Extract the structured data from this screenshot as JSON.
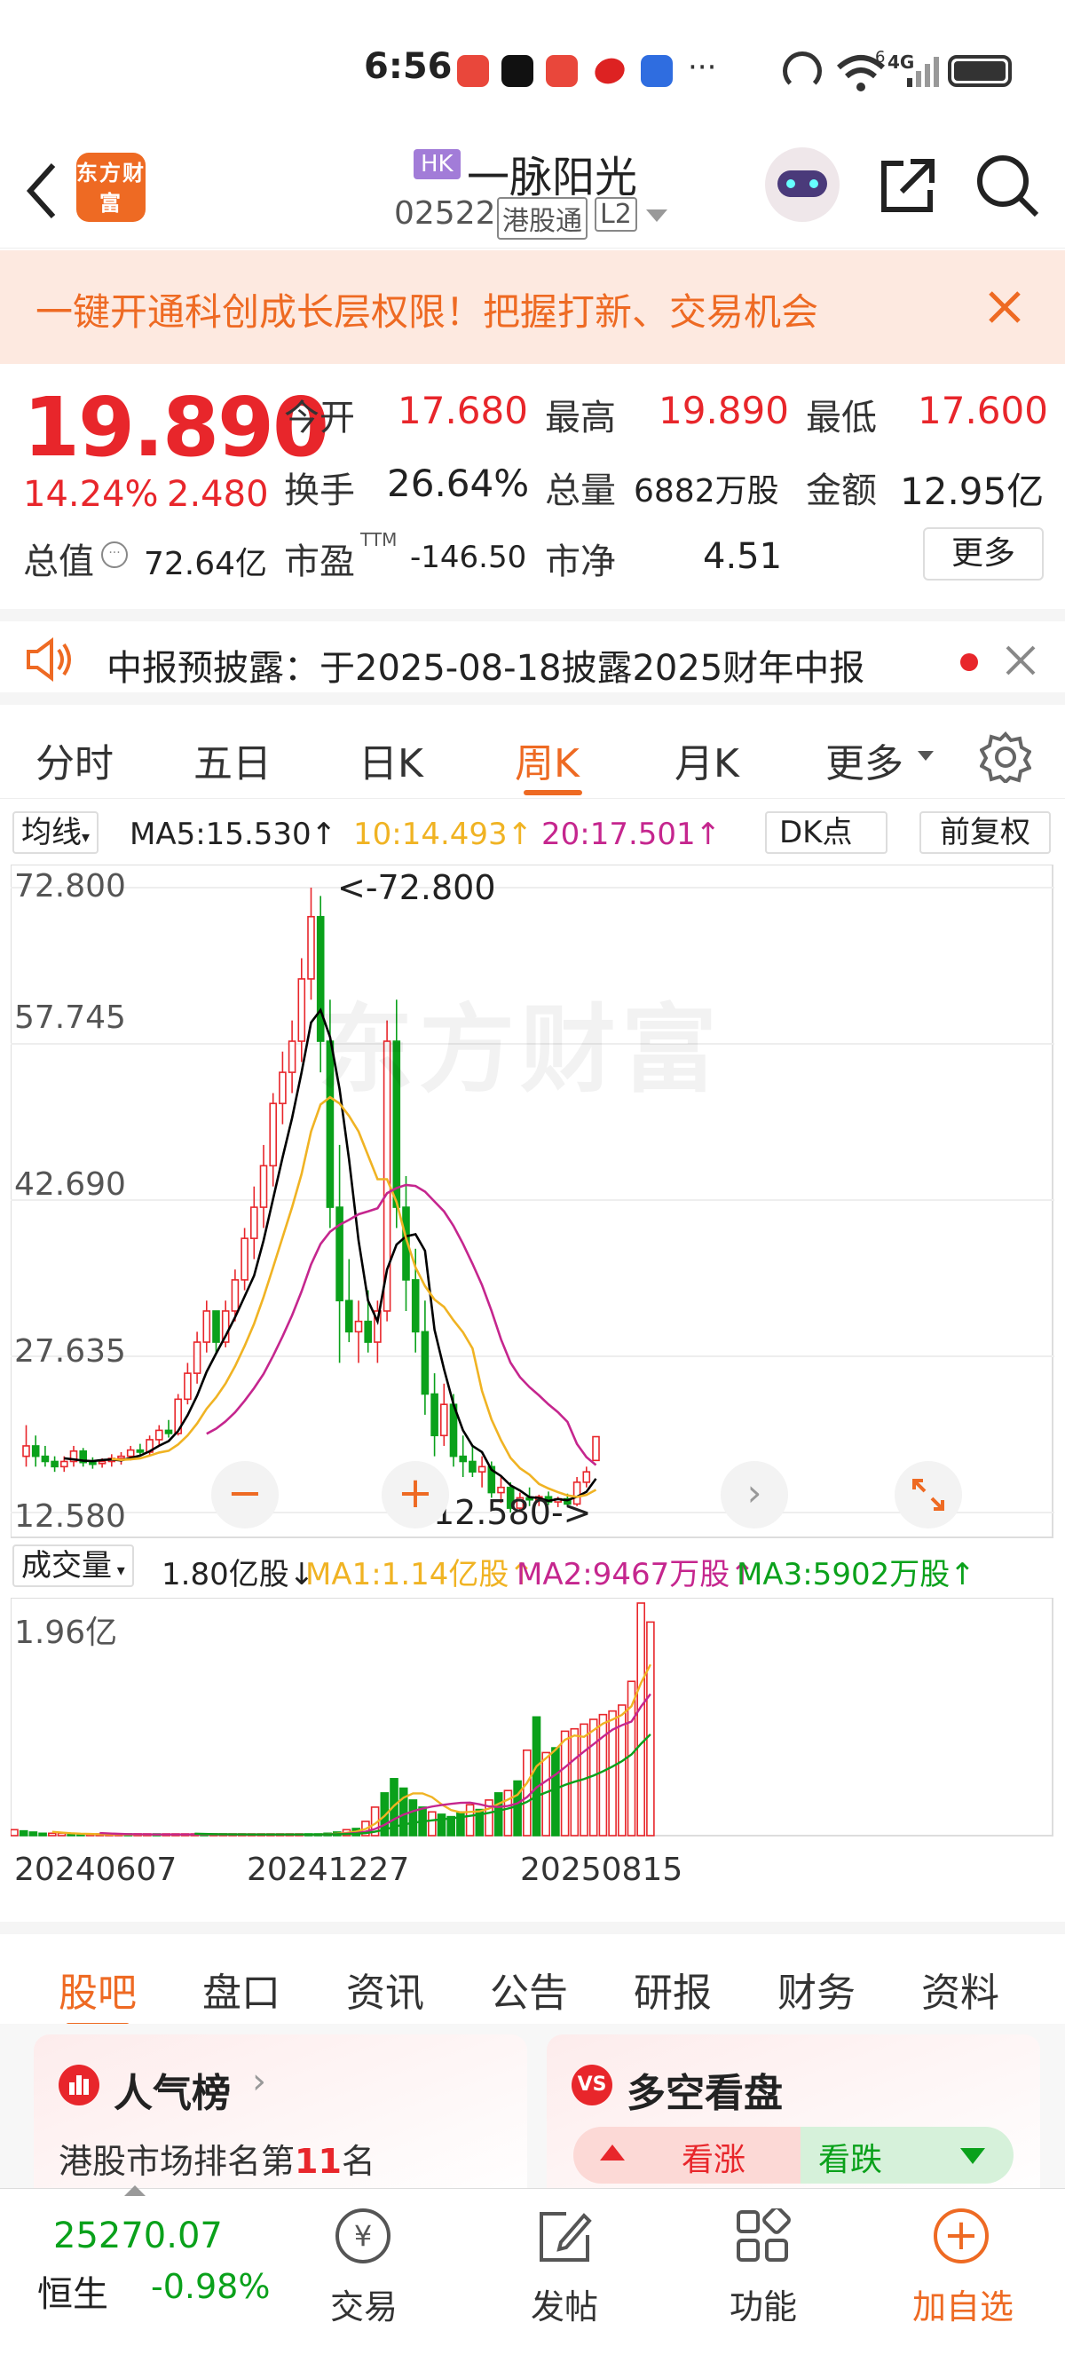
{
  "status": {
    "time": "6:56",
    "signal": "4G",
    "wifi_badge": "6"
  },
  "header": {
    "market_badge": "HK",
    "title": "一脉阳光",
    "code": "02522",
    "channel": "港股通",
    "level": "L2",
    "logo_text": "东方财富"
  },
  "banner": {
    "text": "一键开通科创成长层权限！把握打新、交易机会"
  },
  "quote": {
    "price": "19.890",
    "change_pct": "14.24%",
    "change": "2.480",
    "open_label": "今开",
    "open": "17.680",
    "high_label": "最高",
    "high": "19.890",
    "low_label": "最低",
    "low": "17.600",
    "turnover_label": "换手",
    "turnover": "26.64%",
    "volume_label": "总量",
    "volume": "6882万股",
    "amount_label": "金额",
    "amount": "12.95亿",
    "mcap_label": "总值",
    "mcap": "72.64亿",
    "pe_label": "市盈",
    "pe_sup": "TTM",
    "pe": "-146.50",
    "pb_label": "市净",
    "pb": "4.51",
    "more": "更多"
  },
  "notice": {
    "text": "中报预披露：于2025-08-18披露2025财年中报"
  },
  "ktabs": [
    {
      "label": "分时"
    },
    {
      "label": "五日"
    },
    {
      "label": "日K"
    },
    {
      "label": "周K"
    },
    {
      "label": "月K"
    },
    {
      "label": "更多"
    }
  ],
  "ktab_active": "周K",
  "ma_legend": {
    "type": "均线",
    "ma5": "MA5:15.530↑",
    "ma10": "10:14.493↑",
    "ma20": "20:17.501↑",
    "dk": "DK点",
    "fq": "前复权"
  },
  "kchart_axis": {
    "ticks": [
      "72.800",
      "57.745",
      "42.690",
      "27.635",
      "12.580"
    ],
    "max_label": "<-72.800",
    "min_label": "12.580->"
  },
  "vol_legend": {
    "type": "成交量",
    "value": "1.80亿股↓",
    "ma1": "MA1:1.14亿股↑",
    "ma2": "MA2:9467万股↑",
    "ma3": "MA3:5902万股↑"
  },
  "vol_axis": {
    "max": "1.96亿"
  },
  "dates": [
    "20240607",
    "20241227",
    "20250815"
  ],
  "stabs": [
    {
      "label": "股吧"
    },
    {
      "label": "盘口"
    },
    {
      "label": "资讯"
    },
    {
      "label": "公告"
    },
    {
      "label": "研报"
    },
    {
      "label": "财务"
    },
    {
      "label": "资料"
    }
  ],
  "stab_active": "股吧",
  "cards": {
    "left_title": "人气榜",
    "left_sub_prefix": "港股市场排名第",
    "left_rank": "11",
    "left_sub_suffix": "名",
    "right_title": "多空看盘",
    "bull": "看涨",
    "bear": "看跌"
  },
  "bottomnav": {
    "index_value": "25270.07",
    "index_name": "恒生",
    "index_change": "-0.98%",
    "items": [
      {
        "label": "交易"
      },
      {
        "label": "发帖"
      },
      {
        "label": "功能"
      },
      {
        "label": "加自选"
      }
    ]
  },
  "colors": {
    "up": "#e8262b",
    "down": "#0aa11b",
    "accent": "#ee6a23",
    "ma5": "#000000",
    "ma10": "#f0b323",
    "ma20": "#c5268e"
  },
  "chart_data": {
    "type": "candlestick",
    "period": "weekly",
    "ylim": [
      12.58,
      72.8
    ],
    "x_tick_labels": [
      "20240607",
      "20241227",
      "20250815"
    ],
    "candles": [
      [
        18,
        21,
        17,
        19
      ],
      [
        19,
        20,
        17,
        18
      ],
      [
        18,
        19,
        17,
        17.5
      ],
      [
        17.5,
        18,
        16.5,
        17
      ],
      [
        17,
        18,
        16.5,
        17.5
      ],
      [
        17.5,
        19,
        17,
        18.5
      ],
      [
        18.5,
        18.8,
        17,
        17.4
      ],
      [
        17.4,
        17.9,
        16.8,
        17.3
      ],
      [
        17.3,
        17.8,
        16.9,
        17.5
      ],
      [
        17.5,
        18.2,
        17,
        17.8
      ],
      [
        17.8,
        18.4,
        17.2,
        18
      ],
      [
        18,
        19,
        17.6,
        18.6
      ],
      [
        18.6,
        19.2,
        18,
        18.4
      ],
      [
        18.4,
        20,
        18,
        19.6
      ],
      [
        19.6,
        21,
        19,
        20.5
      ],
      [
        20.5,
        21.5,
        19.8,
        20.2
      ],
      [
        20.2,
        24,
        20,
        23.5
      ],
      [
        23.5,
        27,
        23,
        26
      ],
      [
        26,
        30,
        25,
        29
      ],
      [
        29,
        33,
        28,
        32
      ],
      [
        32,
        31.8,
        28,
        29
      ],
      [
        29,
        33,
        28.5,
        32
      ],
      [
        32,
        36,
        31,
        35
      ],
      [
        35,
        40,
        34,
        39
      ],
      [
        39,
        44,
        37,
        42
      ],
      [
        42,
        48,
        40,
        46
      ],
      [
        46,
        53,
        44,
        52
      ],
      [
        52,
        57,
        50,
        55
      ],
      [
        55,
        60,
        53,
        58
      ],
      [
        58,
        66,
        56,
        64
      ],
      [
        64,
        72.8,
        62,
        70
      ],
      [
        70,
        72,
        55,
        58
      ],
      [
        58,
        62,
        40,
        42
      ],
      [
        42,
        48,
        27,
        33
      ],
      [
        33,
        37,
        29,
        30
      ],
      [
        30,
        33,
        27,
        31
      ],
      [
        31,
        34,
        28,
        29
      ],
      [
        29,
        33,
        27,
        32
      ],
      [
        32,
        60,
        31,
        58
      ],
      [
        58,
        62,
        40,
        42
      ],
      [
        42,
        45,
        32,
        35
      ],
      [
        35,
        38,
        28,
        30
      ],
      [
        30,
        33,
        22,
        24
      ],
      [
        24,
        26,
        18,
        20
      ],
      [
        20,
        25,
        19,
        23
      ],
      [
        23,
        24,
        17,
        18
      ],
      [
        18,
        20,
        16,
        17.5
      ],
      [
        17.5,
        19,
        16,
        16.5
      ],
      [
        16.5,
        18,
        15,
        17
      ],
      [
        17,
        17.5,
        14,
        14.5
      ],
      [
        14.5,
        16,
        13.5,
        15
      ],
      [
        15,
        15.5,
        12.58,
        13
      ],
      [
        13,
        14.5,
        12.7,
        14
      ],
      [
        14,
        15,
        13.2,
        13.8
      ],
      [
        13.8,
        14.3,
        13.2,
        14.1
      ],
      [
        14.1,
        14.6,
        13.3,
        13.6
      ],
      [
        13.6,
        14.1,
        13.1,
        13.9
      ],
      [
        13.9,
        14.4,
        13.2,
        13.4
      ],
      [
        13.4,
        16,
        13.2,
        15.5
      ],
      [
        15.5,
        17,
        15,
        16.5
      ],
      [
        17.6,
        19.89,
        17.6,
        19.89
      ]
    ],
    "volumes": [
      0.05,
      0.04,
      0.03,
      0.02,
      0.02,
      0.02,
      0.01,
      0.01,
      0.01,
      0.01,
      0.01,
      0.01,
      0.01,
      0.01,
      0.01,
      0.01,
      0.01,
      0.01,
      0.01,
      0.01,
      0.01,
      0.01,
      0.01,
      0.01,
      0.01,
      0.01,
      0.01,
      0.01,
      0.01,
      0.01,
      0.01,
      0.01,
      0.01,
      0.02,
      0.03,
      0.05,
      0.06,
      0.12,
      0.24,
      0.36,
      0.48,
      0.4,
      0.3,
      0.24,
      0.2,
      0.18,
      0.16,
      0.2,
      0.26,
      0.22,
      0.3,
      0.36,
      0.38,
      0.46,
      0.72,
      1.0,
      0.7,
      0.74,
      0.88,
      0.9,
      0.94,
      0.98,
      1.02,
      1.05,
      1.1,
      1.3,
      1.96,
      1.8
    ],
    "volume_unit": "亿股"
  }
}
